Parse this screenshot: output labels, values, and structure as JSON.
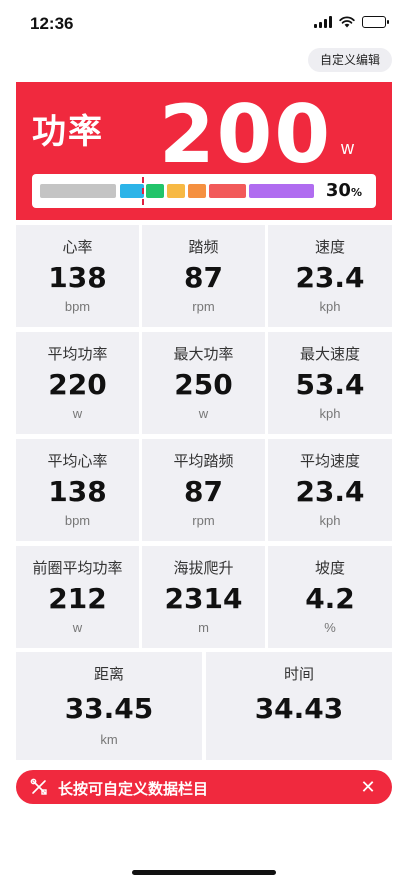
{
  "status_bar": {
    "time": "12:36"
  },
  "toolbar": {
    "edit_label": "自定义编辑"
  },
  "power": {
    "label": "功率",
    "value": "200",
    "unit": "w",
    "zone_percent": "30",
    "zone_percent_unit": "%",
    "zone_colors": [
      "#c4c4c4",
      "#2cb4e8",
      "#22c46a",
      "#f7b944",
      "#f59040",
      "#f25a5a",
      "#b06cf0"
    ]
  },
  "metrics": [
    {
      "title": "心率",
      "value": "138",
      "unit": "bpm"
    },
    {
      "title": "踏频",
      "value": "87",
      "unit": "rpm"
    },
    {
      "title": "速度",
      "value": "23.4",
      "unit": "kph"
    },
    {
      "title": "平均功率",
      "value": "220",
      "unit": "w"
    },
    {
      "title": "最大功率",
      "value": "250",
      "unit": "w"
    },
    {
      "title": "最大速度",
      "value": "53.4",
      "unit": "kph"
    },
    {
      "title": "平均心率",
      "value": "138",
      "unit": "bpm"
    },
    {
      "title": "平均踏频",
      "value": "87",
      "unit": "rpm"
    },
    {
      "title": "平均速度",
      "value": "23.4",
      "unit": "kph"
    },
    {
      "title": "前圈平均功率",
      "value": "212",
      "unit": "w"
    },
    {
      "title": "海拔爬升",
      "value": "2314",
      "unit": "m"
    },
    {
      "title": "坡度",
      "value": "4.2",
      "unit": "%"
    }
  ],
  "metrics_wide": [
    {
      "title": "距离",
      "value": "33.45",
      "unit": "km"
    },
    {
      "title": "时间",
      "value": "34.43",
      "unit": ""
    }
  ],
  "tip": {
    "text": "长按可自定义数据栏目",
    "close": "✕"
  }
}
